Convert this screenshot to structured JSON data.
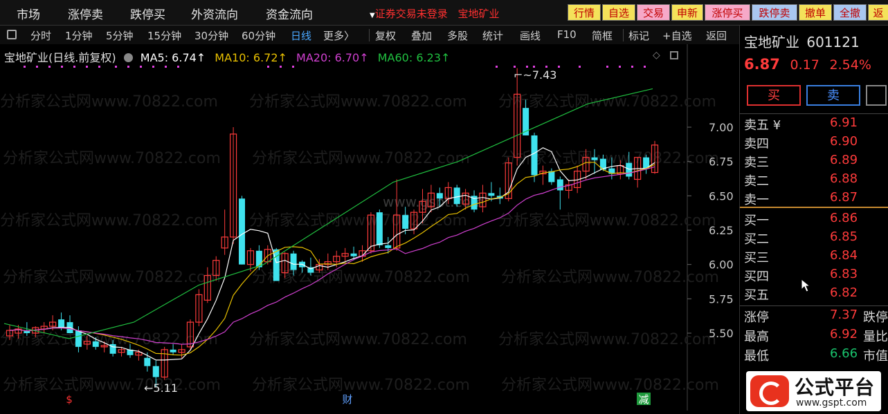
{
  "menu": [
    "市场",
    "涨停卖",
    "跌停买",
    "外资流向",
    "资金流向"
  ],
  "login_notice": "证券交易未登录",
  "login_stock": "宝地矿业",
  "top_buttons": [
    {
      "label": "行情",
      "bg": "#f4e25a"
    },
    {
      "label": "自选",
      "bg": "#f4e25a"
    },
    {
      "label": "交易",
      "bg": "#f6a8c8"
    },
    {
      "label": "申新",
      "bg": "#f4e25a"
    },
    {
      "label": "涨停买",
      "bg": "#f6a8c8"
    },
    {
      "label": "跌停卖",
      "bg": "#a9c7f0"
    },
    {
      "label": "撤单",
      "bg": "#f4e25a"
    },
    {
      "label": "全撤",
      "bg": "#a9c7f0"
    },
    {
      "label": "返",
      "bg": "#f4e25a"
    }
  ],
  "toolbar": [
    "分时",
    "1分钟",
    "5分钟",
    "15分钟",
    "30分钟",
    "60分钟",
    "日线",
    "更多〉",
    "复权",
    "叠加",
    "多股",
    "统计",
    "画线",
    "F10",
    "简框",
    "标记",
    "+自选",
    "返回"
  ],
  "toolbar_active": "日线",
  "indicator": {
    "name": "宝地矿业(日线.前复权)",
    "ma": [
      {
        "label": "MA5: 6.74↑",
        "color": "#ffffff"
      },
      {
        "label": "MA10: 6.72↑",
        "color": "#e8c000"
      },
      {
        "label": "MA20: 6.70↑",
        "color": "#d040d0"
      },
      {
        "label": "MA60: 6.23↑",
        "color": "#20c040"
      }
    ]
  },
  "chart_data": {
    "type": "candlestick",
    "y_ticks": [
      "7.00",
      "6.75",
      "6.50",
      "6.25",
      "6.00",
      "5.75",
      "5.50"
    ],
    "ylim": [
      5.0,
      7.5
    ],
    "high_label": "7.43",
    "low_label": "5.11",
    "ohlc": [
      [
        5.48,
        5.56,
        5.45,
        5.52
      ],
      [
        5.5,
        5.56,
        5.46,
        5.53
      ],
      [
        5.52,
        5.58,
        5.48,
        5.5
      ],
      [
        5.5,
        5.55,
        5.47,
        5.54
      ],
      [
        5.53,
        5.58,
        5.5,
        5.55
      ],
      [
        5.55,
        5.63,
        5.52,
        5.58
      ],
      [
        5.6,
        5.65,
        5.52,
        5.54
      ],
      [
        5.58,
        5.63,
        5.52,
        5.5
      ],
      [
        5.52,
        5.55,
        5.36,
        5.4
      ],
      [
        5.42,
        5.48,
        5.38,
        5.44
      ],
      [
        5.44,
        5.47,
        5.38,
        5.4
      ],
      [
        5.4,
        5.44,
        5.36,
        5.41
      ],
      [
        5.42,
        5.45,
        5.33,
        5.35
      ],
      [
        5.36,
        5.4,
        5.33,
        5.38
      ],
      [
        5.38,
        5.42,
        5.32,
        5.34
      ],
      [
        5.34,
        5.38,
        5.3,
        5.36
      ],
      [
        5.32,
        5.36,
        5.22,
        5.26
      ],
      [
        5.26,
        5.3,
        5.11,
        5.18
      ],
      [
        5.18,
        5.4,
        5.16,
        5.38
      ],
      [
        5.38,
        5.42,
        5.34,
        5.36
      ],
      [
        5.36,
        5.42,
        5.32,
        5.38
      ],
      [
        5.4,
        5.6,
        5.38,
        5.58
      ],
      [
        5.58,
        5.82,
        5.55,
        5.78
      ],
      [
        5.74,
        5.98,
        5.72,
        5.92
      ],
      [
        5.92,
        6.06,
        5.88,
        6.03
      ],
      [
        6.12,
        6.4,
        6.07,
        6.2
      ],
      [
        6.2,
        7.0,
        6.15,
        6.95
      ],
      [
        6.48,
        6.5,
        6.0,
        6.0
      ],
      [
        6.0,
        6.12,
        5.95,
        6.1
      ],
      [
        6.1,
        6.14,
        5.96,
        5.98
      ],
      [
        6.02,
        6.14,
        6.0,
        6.11
      ],
      [
        6.11,
        6.12,
        5.88,
        5.88
      ],
      [
        5.94,
        6.09,
        5.9,
        6.08
      ],
      [
        6.08,
        6.1,
        5.92,
        5.96
      ],
      [
        6.02,
        6.03,
        5.94,
        5.98
      ],
      [
        5.98,
        6.05,
        5.92,
        5.94
      ],
      [
        5.96,
        6.04,
        5.94,
        6.0
      ],
      [
        6.0,
        6.08,
        5.96,
        6.02
      ],
      [
        6.02,
        6.1,
        5.98,
        6.06
      ],
      [
        6.06,
        6.12,
        6.02,
        6.08
      ],
      [
        6.08,
        6.13,
        6.03,
        6.06
      ],
      [
        6.06,
        6.14,
        6.02,
        6.1
      ],
      [
        6.1,
        6.38,
        6.08,
        6.36
      ],
      [
        6.38,
        6.4,
        6.12,
        6.14
      ],
      [
        6.14,
        6.2,
        6.08,
        6.12
      ],
      [
        6.12,
        6.62,
        6.1,
        6.36
      ],
      [
        6.36,
        6.42,
        6.22,
        6.26
      ],
      [
        6.26,
        6.4,
        6.22,
        6.38
      ],
      [
        6.38,
        6.55,
        6.3,
        6.46
      ],
      [
        6.42,
        6.58,
        6.38,
        6.52
      ],
      [
        6.52,
        6.56,
        6.42,
        6.48
      ],
      [
        6.48,
        6.6,
        6.44,
        6.56
      ],
      [
        6.56,
        6.58,
        6.42,
        6.44
      ],
      [
        6.44,
        6.55,
        6.4,
        6.52
      ],
      [
        6.5,
        6.54,
        6.38,
        6.4
      ],
      [
        6.42,
        6.58,
        6.38,
        6.52
      ],
      [
        6.52,
        6.6,
        6.46,
        6.5
      ],
      [
        6.5,
        6.56,
        6.44,
        6.48
      ],
      [
        6.48,
        6.78,
        6.46,
        6.74
      ],
      [
        6.78,
        7.43,
        6.72,
        7.24
      ],
      [
        7.14,
        7.2,
        6.94,
        6.94
      ],
      [
        6.94,
        6.96,
        6.6,
        6.65
      ],
      [
        6.66,
        6.72,
        6.58,
        6.68
      ],
      [
        6.68,
        6.7,
        6.58,
        6.6
      ],
      [
        6.62,
        6.64,
        6.4,
        6.54
      ],
      [
        6.54,
        6.62,
        6.48,
        6.58
      ],
      [
        6.56,
        6.72,
        6.52,
        6.68
      ],
      [
        6.68,
        6.84,
        6.62,
        6.78
      ],
      [
        6.78,
        6.84,
        6.66,
        6.76
      ],
      [
        6.77,
        6.8,
        6.68,
        6.69
      ],
      [
        6.7,
        6.78,
        6.62,
        6.66
      ],
      [
        6.66,
        6.76,
        6.62,
        6.72
      ],
      [
        6.74,
        6.82,
        6.62,
        6.64
      ],
      [
        6.62,
        6.78,
        6.56,
        6.78
      ],
      [
        6.78,
        6.8,
        6.66,
        6.7
      ],
      [
        6.67,
        6.9,
        6.66,
        6.87
      ]
    ],
    "ma_series_colors": [
      "#ffffff",
      "#e8c000",
      "#d040d0",
      "#20c040"
    ],
    "ma_periods": [
      5,
      10,
      20,
      60
    ],
    "ma60_values": [
      5.57,
      5.46,
      5.58,
      5.85,
      6.0,
      6.3,
      6.6,
      6.75,
      6.96,
      7.17,
      7.28
    ],
    "event_markers": [
      {
        "label": "$",
        "color": "#ff3333",
        "bg": "#000"
      },
      {
        "label": "财",
        "color": "#60a0ff",
        "bg": "#000"
      },
      {
        "label": "减",
        "color": "#ffffff",
        "bg": "#1e9a3c"
      }
    ]
  },
  "right_panel": {
    "name": "宝地矿业",
    "code": "601121",
    "price": "6.87",
    "change": "0.17",
    "pct": "2.54%",
    "buy_label": "买",
    "sell_label": "卖",
    "sell_book": [
      {
        "label": "卖五 ¥",
        "price": "6.91"
      },
      {
        "label": "卖四",
        "price": "6.90"
      },
      {
        "label": "卖三",
        "price": "6.89"
      },
      {
        "label": "卖二",
        "price": "6.88"
      },
      {
        "label": "卖一",
        "price": "6.87"
      }
    ],
    "buy_book": [
      {
        "label": "买一",
        "price": "6.86"
      },
      {
        "label": "买二",
        "price": "6.85"
      },
      {
        "label": "买三",
        "price": "6.84"
      },
      {
        "label": "买四",
        "price": "6.83"
      },
      {
        "label": "买五",
        "price": "6.82"
      }
    ],
    "stats": [
      {
        "label": "涨停",
        "value": "7.37",
        "extra": "跌停",
        "cls": "red"
      },
      {
        "label": "最高",
        "value": "6.92",
        "extra": "量比",
        "cls": "red"
      },
      {
        "label": "最低",
        "value": "6.66",
        "extra": "市值",
        "cls": "green"
      }
    ]
  },
  "watermark": "分析家公式网www.70822.com",
  "center_watermark": "www.gspt.com",
  "logo": {
    "main": "公式平台",
    "sub": "www.gspt.com"
  }
}
